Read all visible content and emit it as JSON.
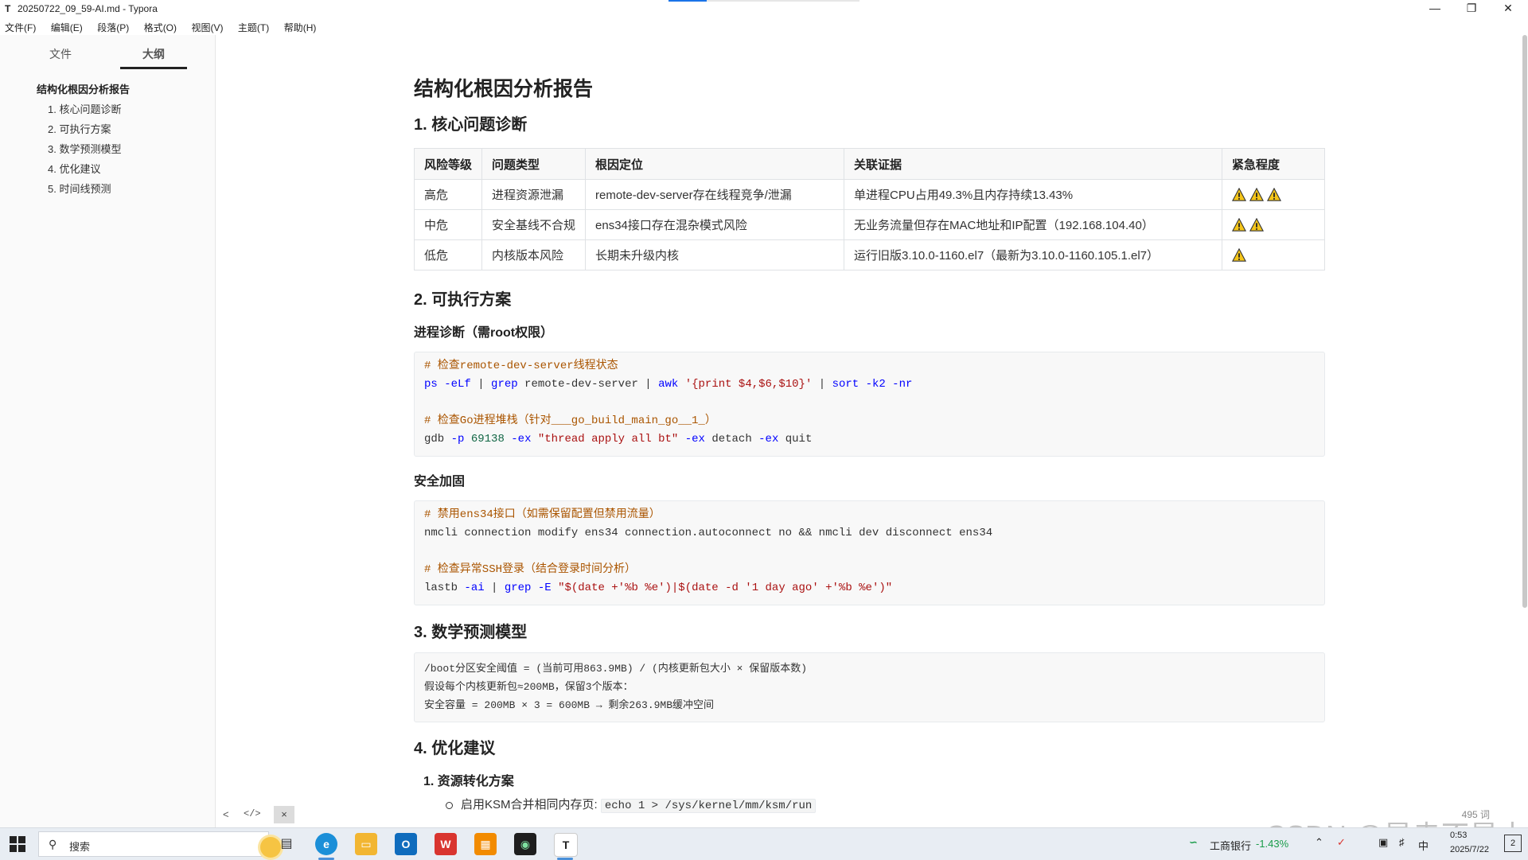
{
  "window": {
    "app_icon": "T",
    "title": "20250722_09_59-AI.md - Typora",
    "minimize": "—",
    "restore": "❐",
    "close": "✕"
  },
  "menu": [
    "文件(F)",
    "编辑(E)",
    "段落(P)",
    "格式(O)",
    "视图(V)",
    "主题(T)",
    "帮助(H)"
  ],
  "sidebar": {
    "tabs": [
      "文件",
      "大纲"
    ],
    "active_tab": "大纲",
    "outline": [
      {
        "level": 1,
        "label": "结构化根因分析报告"
      },
      {
        "level": 2,
        "label": "1. 核心问题诊断"
      },
      {
        "level": 2,
        "label": "2. 可执行方案"
      },
      {
        "level": 2,
        "label": "3. 数学预测模型"
      },
      {
        "level": 2,
        "label": "4. 优化建议"
      },
      {
        "level": 2,
        "label": "5. 时间线预测"
      }
    ],
    "footer": {
      "back": "<",
      "source": "</>",
      "close": "×"
    }
  },
  "doc": {
    "title": "结构化根因分析报告",
    "s1": "1. 核心问题诊断",
    "table": {
      "headers": [
        "风险等级",
        "问题类型",
        "根因定位",
        "关联证据",
        "紧急程度"
      ],
      "rows": [
        {
          "level": "高危",
          "type": "进程资源泄漏",
          "cause": "remote-dev-server存在线程竞争/泄漏",
          "evidence": "单进程CPU占用49.3%且内存持续13.43%",
          "urgency": 3
        },
        {
          "level": "中危",
          "type": "安全基线不合规",
          "cause": "ens34接口存在混杂模式风险",
          "evidence": "无业务流量但存在MAC地址和IP配置（192.168.104.40）",
          "urgency": 2
        },
        {
          "level": "低危",
          "type": "内核版本风险",
          "cause": "长期未升级内核",
          "evidence": "运行旧版3.10.0-1160.el7（最新为3.10.0-1160.105.1.el7）",
          "urgency": 1
        }
      ]
    },
    "s2": "2. 可执行方案",
    "s2_1": "进程诊断（需root权限）",
    "code1": {
      "c1": "# 检查remote-dev-server线程状态",
      "l1_a": "ps",
      "l1_b": " -eLf",
      "l1_c": " | ",
      "l1_d": "grep",
      "l1_e": " remote-dev-server | ",
      "l1_f": "awk",
      "l1_g": " '{print $4,$6,$10}'",
      "l1_h": " | ",
      "l1_i": "sort",
      "l1_j": " -k2 -nr",
      "c2": "# 检查Go进程堆栈（针对___go_build_main_go__1_）",
      "l2_a": "gdb",
      "l2_b": " -p",
      "l2_c": " 69138",
      "l2_d": " -ex",
      "l2_e": " \"thread apply all bt\"",
      "l2_f": " -ex",
      "l2_g": " detach",
      "l2_h": " -ex",
      "l2_i": " quit"
    },
    "s2_2": "安全加固",
    "code2": {
      "c1": "# 禁用ens34接口（如需保留配置但禁用流量）",
      "l1": "nmcli connection modify ens34 connection.autoconnect no && nmcli dev disconnect ens34",
      "c2": "# 检查异常SSH登录（结合登录时间分析）",
      "l2_a": "lastb",
      "l2_b": " -ai",
      "l2_c": " | ",
      "l2_d": "grep",
      "l2_e": " -E",
      "l2_f": " \"$(date +'%b %e')|$(date -d '1 day ago' +'%b %e')\""
    },
    "s3": "3. 数学预测模型",
    "math": [
      "/boot分区安全阈值 = (当前可用863.9MB) / (内核更新包大小 × 保留版本数)",
      "假设每个内核更新包≈200MB，保留3个版本：",
      "安全容量 = 200MB × 3 = 600MB → 剩余263.9MB缓冲空间"
    ],
    "s4": "4. 优化建议",
    "opt1": "1. 资源转化方案",
    "opt1_item1_text": "启用KSM合并相同内存页:",
    "opt1_item1_code": "echo 1 > /sys/kernel/mm/ksm/run",
    "word_count": "495 词"
  },
  "taskbar": {
    "search_icon": "search-icon",
    "search_label": "搜索",
    "bank": "工商银行",
    "bank_change": "-1.43%",
    "ime": "中",
    "time": "0:53",
    "date": "2025/7/22",
    "notif_count": "2"
  },
  "watermark": "CSDN @是走不是土",
  "colors": {
    "accent": "#1a73e8",
    "comment": "#aa5500",
    "keyword": "#0000ff",
    "string": "#aa1111",
    "warning": "#f5c518"
  }
}
